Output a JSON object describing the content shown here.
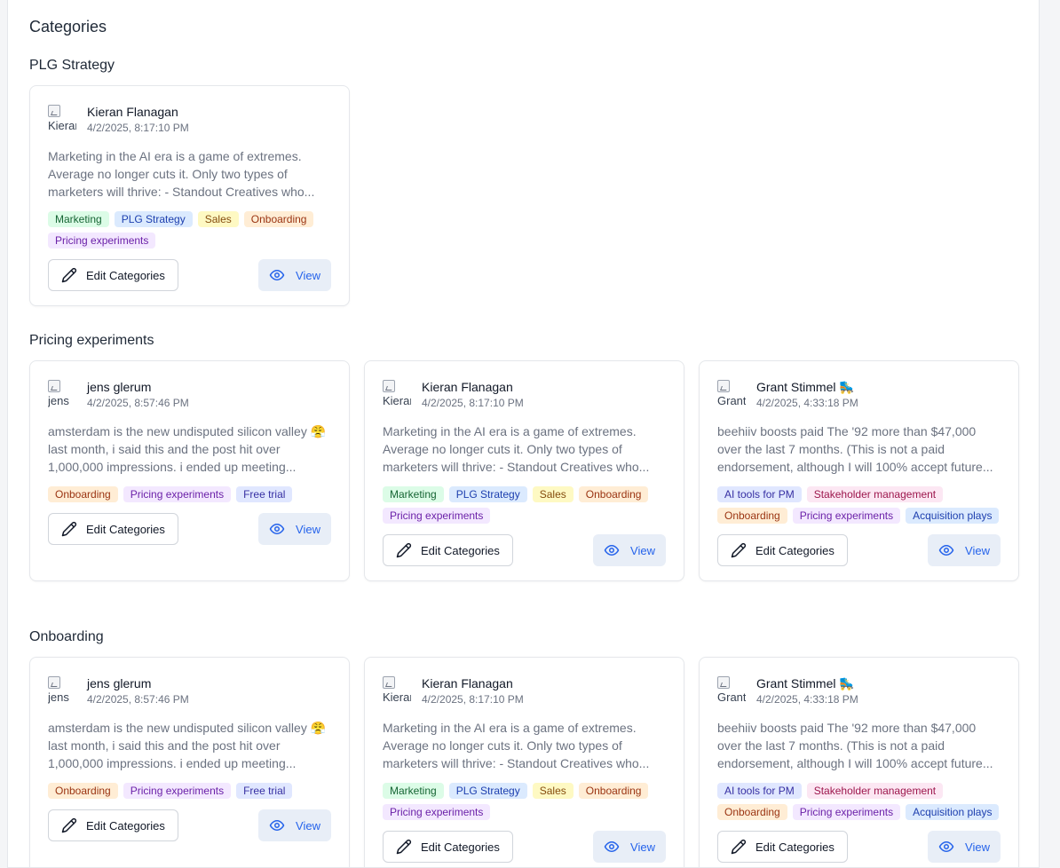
{
  "page": {
    "title": "Categories"
  },
  "labels": {
    "edit": "Edit Categories",
    "view": "View"
  },
  "posts": {
    "kieran": {
      "author": "Kieran Flanagan",
      "avatar_alt": "Kieran",
      "date": "4/2/2025, 8:17:10 PM",
      "excerpt": "Marketing in the AI era is a game of extremes. Average no longer cuts it. Only two types of marketers will thrive: - Standout Creatives who...",
      "tags": [
        {
          "label": "Marketing",
          "color": "green"
        },
        {
          "label": "PLG Strategy",
          "color": "blue"
        },
        {
          "label": "Sales",
          "color": "yellow"
        },
        {
          "label": "Onboarding",
          "color": "orange"
        },
        {
          "label": "Pricing experiments",
          "color": "purple"
        }
      ]
    },
    "jens": {
      "author": "jens glerum",
      "avatar_alt": "jens",
      "date": "4/2/2025, 8:57:46 PM",
      "excerpt": "amsterdam is the new undisputed silicon valley 😤 last month, i said this and the post hit over 1,000,000 impressions. i ended up meeting...",
      "tags": [
        {
          "label": "Onboarding",
          "color": "orange"
        },
        {
          "label": "Pricing experiments",
          "color": "purple"
        },
        {
          "label": "Free trial",
          "color": "indigo"
        }
      ]
    },
    "grant": {
      "author": "Grant Stimmel 🛼",
      "avatar_alt": "Grant",
      "date": "4/2/2025, 4:33:18 PM",
      "excerpt": "beehiiv boosts paid The '92 more than $47,000 over the last 7 months. (This is not a paid endorsement, although I will 100% accept future...",
      "tags": [
        {
          "label": "AI tools for PM",
          "color": "indigo"
        },
        {
          "label": "Stakeholder management",
          "color": "pink"
        },
        {
          "label": "Onboarding",
          "color": "orange"
        },
        {
          "label": "Pricing experiments",
          "color": "purple"
        },
        {
          "label": "Acquisition plays",
          "color": "blue"
        }
      ]
    }
  },
  "sections": [
    {
      "title": "PLG Strategy",
      "posts": [
        "kieran"
      ]
    },
    {
      "title": "Pricing experiments",
      "posts": [
        "jens",
        "kieran",
        "grant"
      ]
    },
    {
      "title": "Onboarding",
      "posts": [
        "jens",
        "kieran",
        "grant"
      ]
    }
  ],
  "colors": {
    "accent": "#2563eb",
    "view_bg": "#e8eef7",
    "border": "#e5e7eb"
  },
  "icons": {
    "edit": "pencil-icon",
    "view": "eye-icon",
    "avatar": "broken-image-icon"
  }
}
